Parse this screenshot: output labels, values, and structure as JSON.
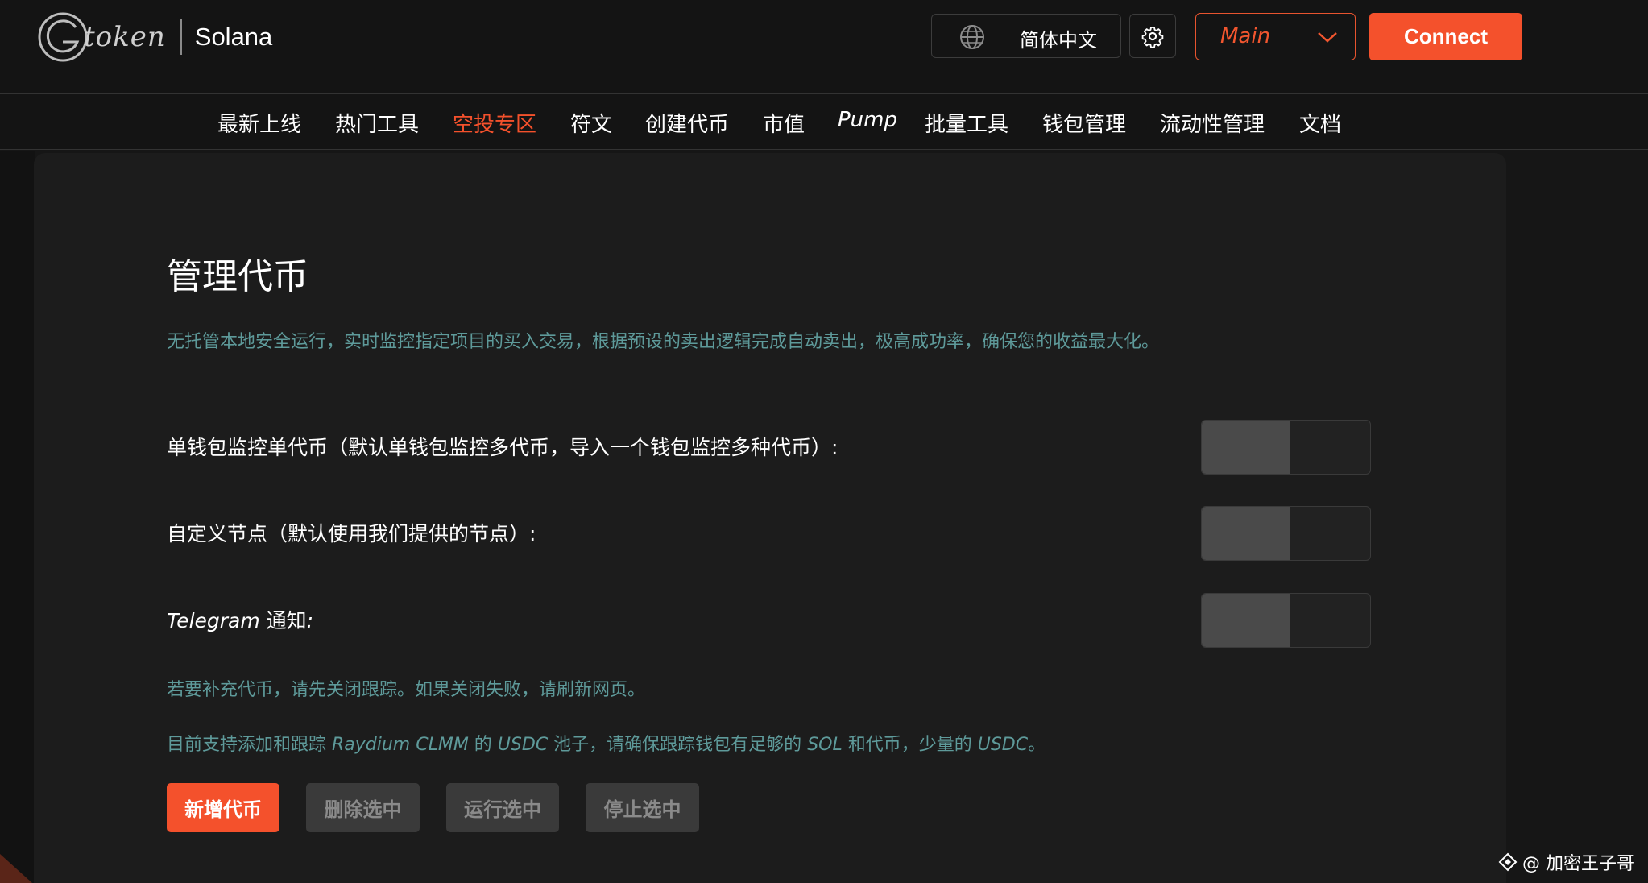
{
  "header": {
    "logo_word": "token",
    "chain": "Solana",
    "language": "简体中文",
    "network": "Main",
    "connect_label": "Connect"
  },
  "nav": {
    "items": [
      "最新上线",
      "热门工具",
      "空投专区",
      "符文",
      "创建代币",
      "市值",
      "Pump",
      "批量工具",
      "钱包管理",
      "流动性管理",
      "文档"
    ],
    "active": "空投专区"
  },
  "main": {
    "title": "管理代币",
    "description": "无托管本地安全运行，实时监控指定项目的买入交易，根据预设的卖出逻辑完成自动卖出，极高成功率，确保您的收益最大化。",
    "settings": [
      {
        "label": "单钱包监控单代币（默认单钱包监控多代币，导入一个钱包监控多种代币）:",
        "enabled": false
      },
      {
        "label": "自定义节点（默认使用我们提供的节点）:",
        "enabled": false
      },
      {
        "label_italic": "Telegram",
        "label": " 通知",
        "label_colon": ":",
        "enabled": false
      }
    ],
    "notes": {
      "note1": "若要补充代币，请先关闭跟踪。如果关闭失败，请刷新网页。",
      "note2_parts": [
        "目前支持添加和跟踪 ",
        "Raydium CLMM",
        " 的 ",
        "USDC",
        " 池子，请确保跟踪钱包有足够的 ",
        "SOL",
        " 和代币，少量的 ",
        "USDC",
        "。"
      ]
    },
    "buttons": {
      "add": "新增代币",
      "delete": "删除选中",
      "run": "运行选中",
      "stop": "停止选中"
    }
  },
  "watermark": "@ 加密王子哥",
  "colors": {
    "accent": "#f4512c",
    "note": "#5e9a9a",
    "background": "#161616"
  }
}
